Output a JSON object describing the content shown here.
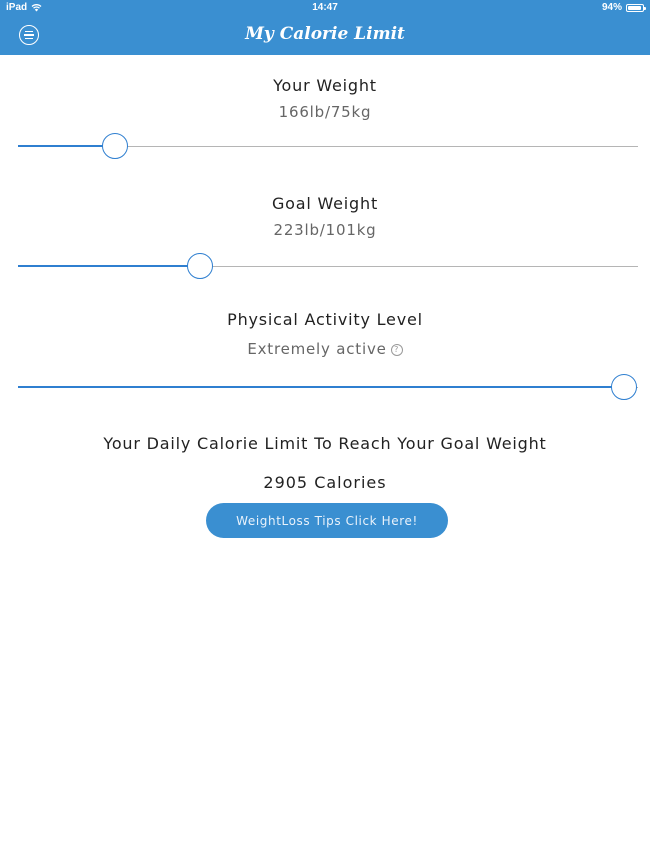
{
  "status_bar": {
    "device": "iPad",
    "time": "14:47",
    "battery": "94%",
    "battery_level": 0.94
  },
  "nav": {
    "title": "My Calorie Limit",
    "menu_icon": "menu-circle-icon"
  },
  "weight": {
    "label": "Your Weight",
    "value": "166lb/75kg",
    "slider_fraction": 0.16
  },
  "goal": {
    "label": "Goal Weight",
    "value": "223lb/101kg",
    "slider_fraction": 0.3
  },
  "activity": {
    "label": "Physical Activity Level",
    "value": "Extremely active",
    "help_icon": "?",
    "slider_fraction": 1.0
  },
  "result": {
    "label": "Your Daily Calorie Limit To Reach Your Goal Weight",
    "value": "2905 Calories"
  },
  "tips_button": {
    "label": "WeightLoss Tips Click Here!"
  },
  "colors": {
    "accent": "#3a8fd1",
    "slider": "#2f7fd0"
  }
}
